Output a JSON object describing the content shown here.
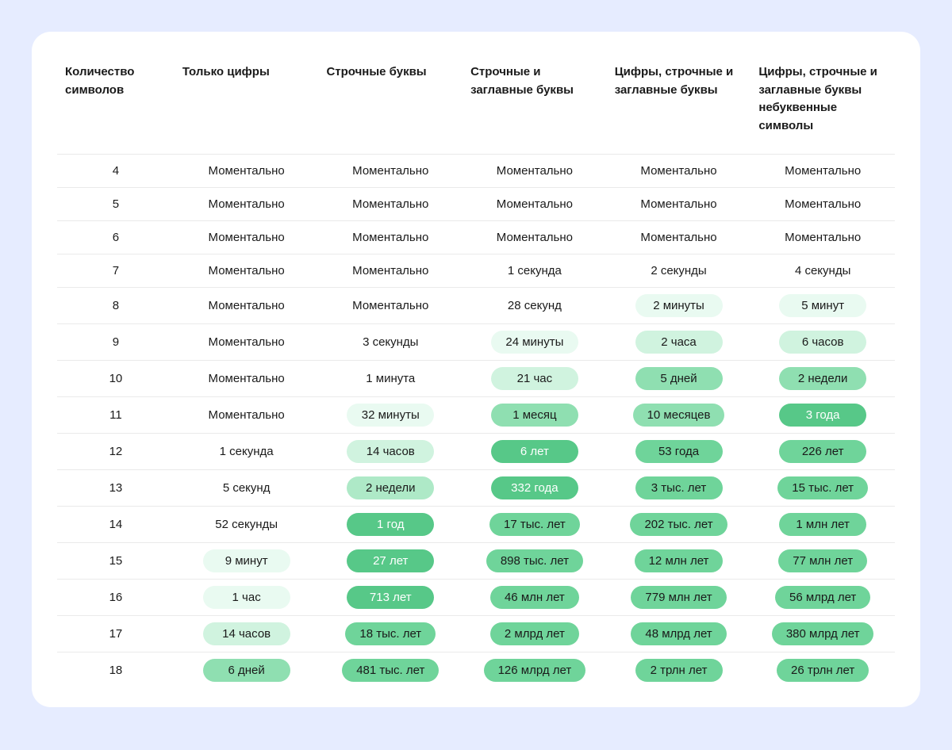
{
  "headers": [
    "Количество символов",
    "Только цифры",
    "Строчные буквы",
    "Строчные и заглавные буквы",
    "Цифры, строчные и заглавные буквы",
    "Цифры, строчные и заглавные буквы небуквенные символы"
  ],
  "rows": [
    {
      "n": "4",
      "cells": [
        {
          "text": "Моментально",
          "lvl": 0
        },
        {
          "text": "Моментально",
          "lvl": 0
        },
        {
          "text": "Моментально",
          "lvl": 0
        },
        {
          "text": "Моментально",
          "lvl": 0
        },
        {
          "text": "Моментально",
          "lvl": 0
        }
      ]
    },
    {
      "n": "5",
      "cells": [
        {
          "text": "Моментально",
          "lvl": 0
        },
        {
          "text": "Моментально",
          "lvl": 0
        },
        {
          "text": "Моментально",
          "lvl": 0
        },
        {
          "text": "Моментально",
          "lvl": 0
        },
        {
          "text": "Моментально",
          "lvl": 0
        }
      ]
    },
    {
      "n": "6",
      "cells": [
        {
          "text": "Моментально",
          "lvl": 0
        },
        {
          "text": "Моментально",
          "lvl": 0
        },
        {
          "text": "Моментально",
          "lvl": 0
        },
        {
          "text": "Моментально",
          "lvl": 0
        },
        {
          "text": "Моментально",
          "lvl": 0
        }
      ]
    },
    {
      "n": "7",
      "cells": [
        {
          "text": "Моментально",
          "lvl": 0
        },
        {
          "text": "Моментально",
          "lvl": 0
        },
        {
          "text": "1 секунда",
          "lvl": 0
        },
        {
          "text": "2 секунды",
          "lvl": 0
        },
        {
          "text": "4 секунды",
          "lvl": 0
        }
      ]
    },
    {
      "n": "8",
      "cells": [
        {
          "text": "Моментально",
          "lvl": 0
        },
        {
          "text": "Моментально",
          "lvl": 0
        },
        {
          "text": "28 секунд",
          "lvl": 0
        },
        {
          "text": "2 минуты",
          "lvl": 1
        },
        {
          "text": "5 минут",
          "lvl": 1
        }
      ]
    },
    {
      "n": "9",
      "cells": [
        {
          "text": "Моментально",
          "lvl": 0
        },
        {
          "text": "3 секунды",
          "lvl": 0
        },
        {
          "text": "24 минуты",
          "lvl": 1
        },
        {
          "text": "2 часа",
          "lvl": 2
        },
        {
          "text": "6 часов",
          "lvl": 2
        }
      ]
    },
    {
      "n": "10",
      "cells": [
        {
          "text": "Моментально",
          "lvl": 0
        },
        {
          "text": "1 минута",
          "lvl": 0
        },
        {
          "text": "21 час",
          "lvl": 2
        },
        {
          "text": "5 дней",
          "lvl": 4
        },
        {
          "text": "2 недели",
          "lvl": 4
        }
      ]
    },
    {
      "n": "11",
      "cells": [
        {
          "text": "Моментально",
          "lvl": 0
        },
        {
          "text": "32 минуты",
          "lvl": 1
        },
        {
          "text": "1 месяц",
          "lvl": 4
        },
        {
          "text": "10 месяцев",
          "lvl": 4
        },
        {
          "text": "3 года",
          "lvl": 6
        }
      ]
    },
    {
      "n": "12",
      "cells": [
        {
          "text": "1 секунда",
          "lvl": 0
        },
        {
          "text": "14 часов",
          "lvl": 2
        },
        {
          "text": "6 лет",
          "lvl": 6
        },
        {
          "text": "53 года",
          "lvl": 5
        },
        {
          "text": "226 лет",
          "lvl": 5
        }
      ]
    },
    {
      "n": "13",
      "cells": [
        {
          "text": "5 секунд",
          "lvl": 0
        },
        {
          "text": "2 недели",
          "lvl": 3
        },
        {
          "text": "332 года",
          "lvl": 6
        },
        {
          "text": "3 тыс. лет",
          "lvl": 5
        },
        {
          "text": "15 тыс. лет",
          "lvl": 5
        }
      ]
    },
    {
      "n": "14",
      "cells": [
        {
          "text": "52 секунды",
          "lvl": 0
        },
        {
          "text": "1 год",
          "lvl": 6
        },
        {
          "text": "17 тыс. лет",
          "lvl": 5
        },
        {
          "text": "202 тыс. лет",
          "lvl": 5
        },
        {
          "text": "1 млн лет",
          "lvl": 5
        }
      ]
    },
    {
      "n": "15",
      "cells": [
        {
          "text": "9 минут",
          "lvl": 1
        },
        {
          "text": "27 лет",
          "lvl": 6
        },
        {
          "text": "898 тыс. лет",
          "lvl": 5
        },
        {
          "text": "12 млн лет",
          "lvl": 5
        },
        {
          "text": "77 млн лет",
          "lvl": 5
        }
      ]
    },
    {
      "n": "16",
      "cells": [
        {
          "text": "1 час",
          "lvl": 1
        },
        {
          "text": "713 лет",
          "lvl": 6
        },
        {
          "text": "46 млн лет",
          "lvl": 5
        },
        {
          "text": "779 млн лет",
          "lvl": 5
        },
        {
          "text": "56 млрд лет",
          "lvl": 5
        }
      ]
    },
    {
      "n": "17",
      "cells": [
        {
          "text": "14 часов",
          "lvl": 2
        },
        {
          "text": "18 тыс. лет",
          "lvl": 5
        },
        {
          "text": "2 млрд лет",
          "lvl": 5
        },
        {
          "text": "48 млрд лет",
          "lvl": 5
        },
        {
          "text": "380 млрд лет",
          "lvl": 5
        }
      ]
    },
    {
      "n": "18",
      "cells": [
        {
          "text": "6 дней",
          "lvl": 4
        },
        {
          "text": "481 тыс. лет",
          "lvl": 5
        },
        {
          "text": "126 млрд лет",
          "lvl": 5
        },
        {
          "text": "2 трлн лет",
          "lvl": 5
        },
        {
          "text": "26 трлн лет",
          "lvl": 5
        }
      ]
    }
  ]
}
